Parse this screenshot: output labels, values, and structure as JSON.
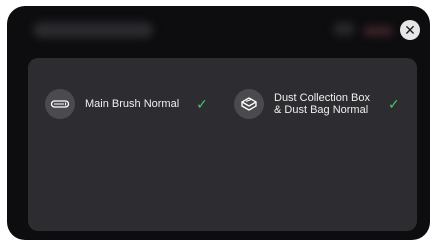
{
  "dialog": {
    "close_glyph": "✕"
  },
  "status": {
    "items": [
      {
        "icon": "main-brush-icon",
        "label": "Main Brush Normal",
        "check": "✓"
      },
      {
        "icon": "dust-box-icon",
        "label_line1": "Dust Collection Box",
        "label_line2": "& Dust Bag Normal",
        "check": "✓"
      }
    ]
  },
  "colors": {
    "modal_bg": "#0d0d0f",
    "panel_bg": "#2d2d31",
    "icon_bg": "#4a4a4f",
    "ok_green": "#4cc46a"
  }
}
